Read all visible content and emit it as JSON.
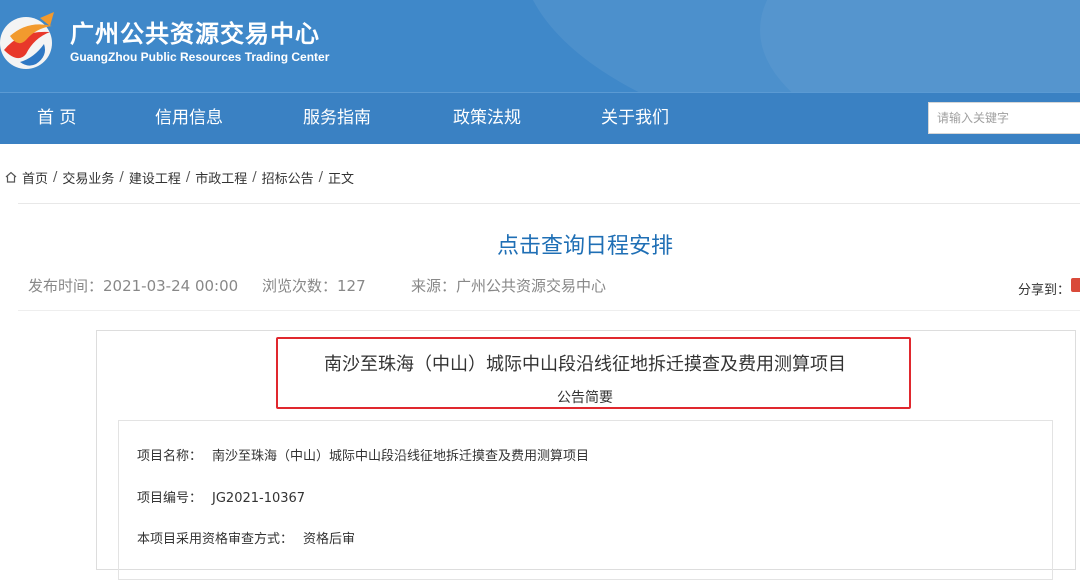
{
  "header": {
    "title": "广州公共资源交易中心",
    "subtitle": "GuangZhou Public Resources Trading Center",
    "brand_color": "#3f88c9",
    "logo_icon": "logo-globe-icon"
  },
  "nav": {
    "items": [
      {
        "label": "首 页"
      },
      {
        "label": "信用信息"
      },
      {
        "label": "服务指南"
      },
      {
        "label": "政策法规"
      },
      {
        "label": "关于我们"
      }
    ],
    "search_placeholder": "请输入关键字"
  },
  "breadcrumb": {
    "items": [
      "首页",
      "交易业务",
      "建设工程",
      "市政工程",
      "招标公告",
      "正文"
    ],
    "separator": "/"
  },
  "article": {
    "schedule_link": "点击查询日程安排",
    "publish_time": "发布时间：2021-03-24 00:00",
    "views": "浏览次数：127",
    "source": "来源：广州公共资源交易中心",
    "share_label": "分享到：",
    "highlight_color": "#e0282e",
    "project_title": "南沙至珠海（中山）城际中山段沿线征地拆迁摸查及费用测算项目",
    "summary_label": "公告简要",
    "fields": [
      {
        "label": "项目名称：",
        "value": "南沙至珠海（中山）城际中山段沿线征地拆迁摸查及费用测算项目"
      },
      {
        "label": "项目编号：",
        "value": "JG2021-10367"
      },
      {
        "label": "本项目采用资格审查方式：",
        "value": "资格后审"
      }
    ]
  }
}
